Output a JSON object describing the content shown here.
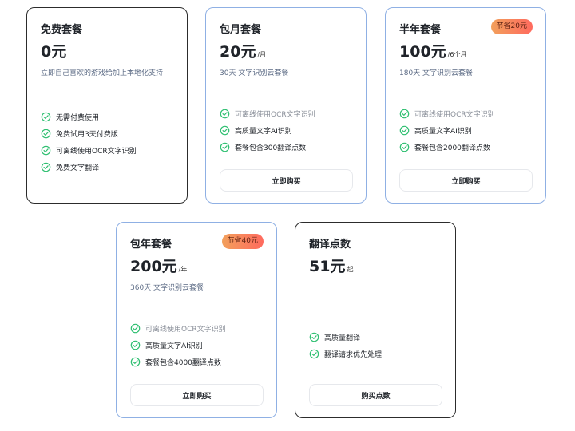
{
  "colors": {
    "check": "#2fbf71",
    "card_border_active": "#8fb0e4",
    "badge_from": "#f2a05c",
    "badge_to": "#ff6a5e"
  },
  "plans": [
    {
      "title": "免费套餐",
      "price": "0元",
      "unit": "",
      "desc": "立即自己喜欢的游戏给加上本地化支持",
      "features": [
        "无需付费使用",
        "免费试用3天付费版",
        "可离线使用OCR文字识别",
        "免费文字翻译"
      ]
    },
    {
      "title": "包月套餐",
      "price": "20元",
      "unit": "/月",
      "desc": "30天 文字识别云套餐",
      "features": [
        "可离线使用OCR文字识别",
        "高质量文字AI识别",
        "套餐包含300翻译点数"
      ],
      "button": "立即购买"
    },
    {
      "title": "半年套餐",
      "price": "100元",
      "unit": "/6个月",
      "desc": "180天 文字识别云套餐",
      "badge": "节省20元",
      "features": [
        "可离线使用OCR文字识别",
        "高质量文字AI识别",
        "套餐包含2000翻译点数"
      ],
      "button": "立即购买"
    },
    {
      "title": "包年套餐",
      "price": "200元",
      "unit": "/年",
      "desc": "360天 文字识别云套餐",
      "badge": "节省40元",
      "features": [
        "可离线使用OCR文字识别",
        "高质量文字AI识别",
        "套餐包含4000翻译点数"
      ],
      "button": "立即购买"
    },
    {
      "title": "翻译点数",
      "price": "51元",
      "unit": "起",
      "features": [
        "高质量翻译",
        "翻译请求优先处理"
      ],
      "button": "购买点数"
    }
  ]
}
